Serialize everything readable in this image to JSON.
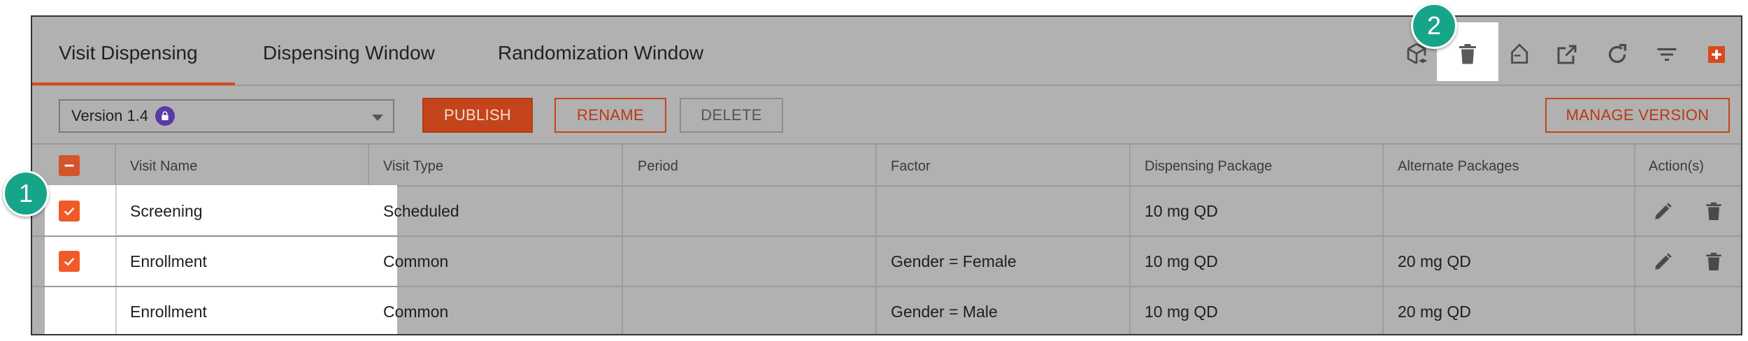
{
  "tabs": [
    {
      "label": "Visit Dispensing",
      "active": true
    },
    {
      "label": "Dispensing Window",
      "active": false
    },
    {
      "label": "Randomization Window",
      "active": false
    }
  ],
  "toolbar": {
    "icons": [
      "cube-link-icon",
      "trash-icon",
      "tag-edit-icon",
      "open-external-icon",
      "refresh-icon",
      "filter-icon",
      "add-icon"
    ]
  },
  "version": {
    "selected": "Version 1.4",
    "locked": true
  },
  "buttons": {
    "publish": "PUBLISH",
    "rename": "RENAME",
    "delete": "DELETE",
    "manage_version": "MANAGE VERSION"
  },
  "table": {
    "headers": [
      "Visit Name",
      "Visit Type",
      "Period",
      "Factor",
      "Dispensing Package",
      "Alternate Packages",
      "Action(s)"
    ],
    "rows": [
      {
        "visit_name": "Screening",
        "visit_type": "Scheduled",
        "period": "",
        "factor": "",
        "dispensing_package": "10 mg QD",
        "alternate_packages": "",
        "checked": true
      },
      {
        "visit_name": "Enrollment",
        "visit_type": "Common",
        "period": "",
        "factor": "Gender = Female",
        "dispensing_package": "10 mg QD",
        "alternate_packages": "20 mg QD",
        "checked": true
      },
      {
        "visit_name": "Enrollment",
        "visit_type": "Common",
        "period": "",
        "factor": "Gender = Male",
        "dispensing_package": "10 mg QD",
        "alternate_packages": "20 mg QD",
        "checked": null
      }
    ]
  },
  "callouts": {
    "one": "1",
    "two": "2"
  },
  "colors": {
    "accent": "#f05a28",
    "callout": "#17a589",
    "overlay": "#b1b1b1"
  }
}
